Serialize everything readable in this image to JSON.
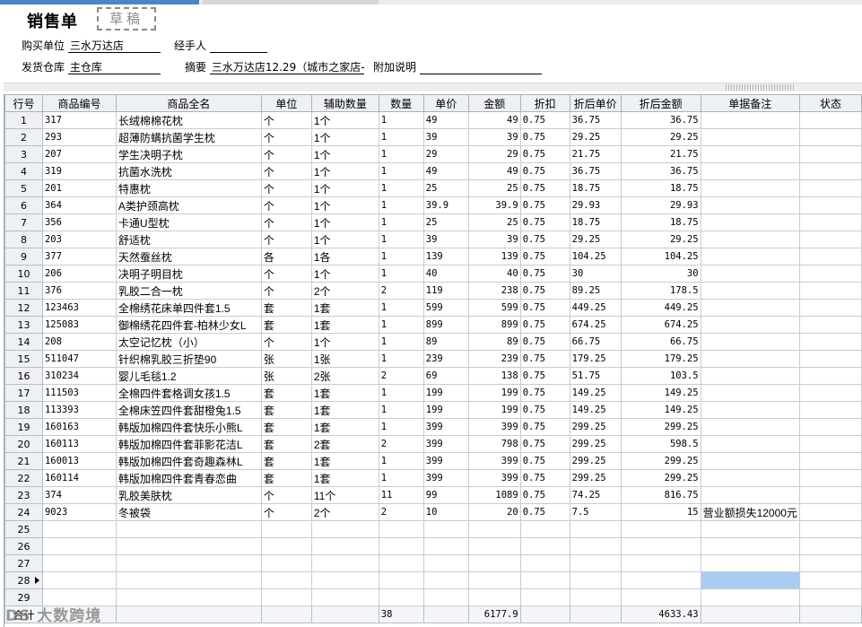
{
  "header": {
    "title": "销售单",
    "stamp": "草稿",
    "buyer_label": "购买单位",
    "buyer_value": "三水万达店",
    "handler_label": "经手人",
    "handler_value": "",
    "warehouse_label": "发货仓库",
    "warehouse_value": "主仓库",
    "summary_label": "摘要",
    "summary_value": "三水万达店12.29（城市之家店->",
    "note_label": "附加说明",
    "note_value": ""
  },
  "columns": [
    "行号",
    "商品编号",
    "商品全名",
    "单位",
    "辅助数量",
    "数量",
    "单价",
    "金额",
    "折扣",
    "折后单价",
    "折后金额",
    "单据备注",
    "状态"
  ],
  "rows": [
    {
      "no": "1",
      "code": "317",
      "name": "长绒棉棉花枕",
      "unit": "个",
      "aux": "1个",
      "qty": "1",
      "price": "49",
      "amount": "49",
      "discount": "0.75",
      "dprice": "36.75",
      "damount": "36.75",
      "remark": "",
      "status": ""
    },
    {
      "no": "2",
      "code": "293",
      "name": "超薄防螨抗菌学生枕",
      "unit": "个",
      "aux": "1个",
      "qty": "1",
      "price": "39",
      "amount": "39",
      "discount": "0.75",
      "dprice": "29.25",
      "damount": "29.25",
      "remark": "",
      "status": ""
    },
    {
      "no": "3",
      "code": "207",
      "name": "学生决明子枕",
      "unit": "个",
      "aux": "1个",
      "qty": "1",
      "price": "29",
      "amount": "29",
      "discount": "0.75",
      "dprice": "21.75",
      "damount": "21.75",
      "remark": "",
      "status": ""
    },
    {
      "no": "4",
      "code": "319",
      "name": "抗菌水洗枕",
      "unit": "个",
      "aux": "1个",
      "qty": "1",
      "price": "49",
      "amount": "49",
      "discount": "0.75",
      "dprice": "36.75",
      "damount": "36.75",
      "remark": "",
      "status": ""
    },
    {
      "no": "5",
      "code": "201",
      "name": "特惠枕",
      "unit": "个",
      "aux": "1个",
      "qty": "1",
      "price": "25",
      "amount": "25",
      "discount": "0.75",
      "dprice": "18.75",
      "damount": "18.75",
      "remark": "",
      "status": ""
    },
    {
      "no": "6",
      "code": "364",
      "name": "A类护颈高枕",
      "unit": "个",
      "aux": "1个",
      "qty": "1",
      "price": "39.9",
      "amount": "39.9",
      "discount": "0.75",
      "dprice": "29.93",
      "damount": "29.93",
      "remark": "",
      "status": ""
    },
    {
      "no": "7",
      "code": "356",
      "name": "卡通U型枕",
      "unit": "个",
      "aux": "1个",
      "qty": "1",
      "price": "25",
      "amount": "25",
      "discount": "0.75",
      "dprice": "18.75",
      "damount": "18.75",
      "remark": "",
      "status": ""
    },
    {
      "no": "8",
      "code": "203",
      "name": "舒适枕",
      "unit": "个",
      "aux": "1个",
      "qty": "1",
      "price": "39",
      "amount": "39",
      "discount": "0.75",
      "dprice": "29.25",
      "damount": "29.25",
      "remark": "",
      "status": ""
    },
    {
      "no": "9",
      "code": "377",
      "name": "天然蚕丝枕",
      "unit": "各",
      "aux": "1各",
      "qty": "1",
      "price": "139",
      "amount": "139",
      "discount": "0.75",
      "dprice": "104.25",
      "damount": "104.25",
      "remark": "",
      "status": ""
    },
    {
      "no": "10",
      "code": "206",
      "name": "决明子明目枕",
      "unit": "个",
      "aux": "1个",
      "qty": "1",
      "price": "40",
      "amount": "40",
      "discount": "0.75",
      "dprice": "30",
      "damount": "30",
      "remark": "",
      "status": ""
    },
    {
      "no": "11",
      "code": "376",
      "name": "乳胶二合一枕",
      "unit": "个",
      "aux": "2个",
      "qty": "2",
      "price": "119",
      "amount": "238",
      "discount": "0.75",
      "dprice": "89.25",
      "damount": "178.5",
      "remark": "",
      "status": ""
    },
    {
      "no": "12",
      "code": "123463",
      "name": "全棉绣花床单四件套1.5",
      "unit": "套",
      "aux": "1套",
      "qty": "1",
      "price": "599",
      "amount": "599",
      "discount": "0.75",
      "dprice": "449.25",
      "damount": "449.25",
      "remark": "",
      "status": ""
    },
    {
      "no": "13",
      "code": "125083",
      "name": "御棉绣花四件套-柏林少女L",
      "unit": "套",
      "aux": "1套",
      "qty": "1",
      "price": "899",
      "amount": "899",
      "discount": "0.75",
      "dprice": "674.25",
      "damount": "674.25",
      "remark": "",
      "status": ""
    },
    {
      "no": "14",
      "code": "208",
      "name": "太空记忆枕（小）",
      "unit": "个",
      "aux": "1个",
      "qty": "1",
      "price": "89",
      "amount": "89",
      "discount": "0.75",
      "dprice": "66.75",
      "damount": "66.75",
      "remark": "",
      "status": ""
    },
    {
      "no": "15",
      "code": "511047",
      "name": "针织棉乳胶三折垫90",
      "unit": "张",
      "aux": "1张",
      "qty": "1",
      "price": "239",
      "amount": "239",
      "discount": "0.75",
      "dprice": "179.25",
      "damount": "179.25",
      "remark": "",
      "status": ""
    },
    {
      "no": "16",
      "code": "310234",
      "name": "婴儿毛毯1.2",
      "unit": "张",
      "aux": "2张",
      "qty": "2",
      "price": "69",
      "amount": "138",
      "discount": "0.75",
      "dprice": "51.75",
      "damount": "103.5",
      "remark": "",
      "status": ""
    },
    {
      "no": "17",
      "code": "111503",
      "name": "全棉四件套格调女孩1.5",
      "unit": "套",
      "aux": "1套",
      "qty": "1",
      "price": "199",
      "amount": "199",
      "discount": "0.75",
      "dprice": "149.25",
      "damount": "149.25",
      "remark": "",
      "status": ""
    },
    {
      "no": "18",
      "code": "113393",
      "name": "全棉床笠四件套甜橙兔1.5",
      "unit": "套",
      "aux": "1套",
      "qty": "1",
      "price": "199",
      "amount": "199",
      "discount": "0.75",
      "dprice": "149.25",
      "damount": "149.25",
      "remark": "",
      "status": ""
    },
    {
      "no": "19",
      "code": "160163",
      "name": "韩版加棉四件套快乐小熊L",
      "unit": "套",
      "aux": "1套",
      "qty": "1",
      "price": "399",
      "amount": "399",
      "discount": "0.75",
      "dprice": "299.25",
      "damount": "299.25",
      "remark": "",
      "status": ""
    },
    {
      "no": "20",
      "code": "160113",
      "name": "韩版加棉四件套菲影花洁L",
      "unit": "套",
      "aux": "2套",
      "qty": "2",
      "price": "399",
      "amount": "798",
      "discount": "0.75",
      "dprice": "299.25",
      "damount": "598.5",
      "remark": "",
      "status": ""
    },
    {
      "no": "21",
      "code": "160013",
      "name": "韩版加棉四件套奇趣森林L",
      "unit": "套",
      "aux": "1套",
      "qty": "1",
      "price": "399",
      "amount": "399",
      "discount": "0.75",
      "dprice": "299.25",
      "damount": "299.25",
      "remark": "",
      "status": ""
    },
    {
      "no": "22",
      "code": "160114",
      "name": "韩版加棉四件套青春恋曲",
      "unit": "套",
      "aux": "1套",
      "qty": "1",
      "price": "399",
      "amount": "399",
      "discount": "0.75",
      "dprice": "299.25",
      "damount": "299.25",
      "remark": "",
      "status": ""
    },
    {
      "no": "23",
      "code": "374",
      "name": "乳胶美肤枕",
      "unit": "个",
      "aux": "11个",
      "qty": "11",
      "price": "99",
      "amount": "1089",
      "discount": "0.75",
      "dprice": "74.25",
      "damount": "816.75",
      "remark": "",
      "status": ""
    },
    {
      "no": "24",
      "code": "9023",
      "name": "冬被袋",
      "unit": "个",
      "aux": "2个",
      "qty": "2",
      "price": "10",
      "amount": "20",
      "discount": "0.75",
      "dprice": "7.5",
      "damount": "15",
      "remark": "营业额损失12000元",
      "status": ""
    },
    {
      "no": "25",
      "code": "",
      "name": "",
      "unit": "",
      "aux": "",
      "qty": "",
      "price": "",
      "amount": "",
      "discount": "",
      "dprice": "",
      "damount": "",
      "remark": "",
      "status": ""
    },
    {
      "no": "26",
      "code": "",
      "name": "",
      "unit": "",
      "aux": "",
      "qty": "",
      "price": "",
      "amount": "",
      "discount": "",
      "dprice": "",
      "damount": "",
      "remark": "",
      "status": ""
    },
    {
      "no": "27",
      "code": "",
      "name": "",
      "unit": "",
      "aux": "",
      "qty": "",
      "price": "",
      "amount": "",
      "discount": "",
      "dprice": "",
      "damount": "",
      "remark": "",
      "status": ""
    },
    {
      "no": "28",
      "code": "",
      "name": "",
      "unit": "",
      "aux": "",
      "qty": "",
      "price": "",
      "amount": "",
      "discount": "",
      "dprice": "",
      "damount": "",
      "remark": "",
      "status": "",
      "current": true
    },
    {
      "no": "29",
      "code": "",
      "name": "",
      "unit": "",
      "aux": "",
      "qty": "",
      "price": "",
      "amount": "",
      "discount": "",
      "dprice": "",
      "damount": "",
      "remark": "",
      "status": ""
    }
  ],
  "totals": {
    "label": "合计",
    "qty": "38",
    "amount": "6177.9",
    "damount": "4633.43"
  },
  "watermark": "DS 大数跨境",
  "colors": {
    "selected_cell": "#a9cdf0",
    "header_bg": "#eef0f3",
    "tab_accent": "#4a86c8"
  }
}
